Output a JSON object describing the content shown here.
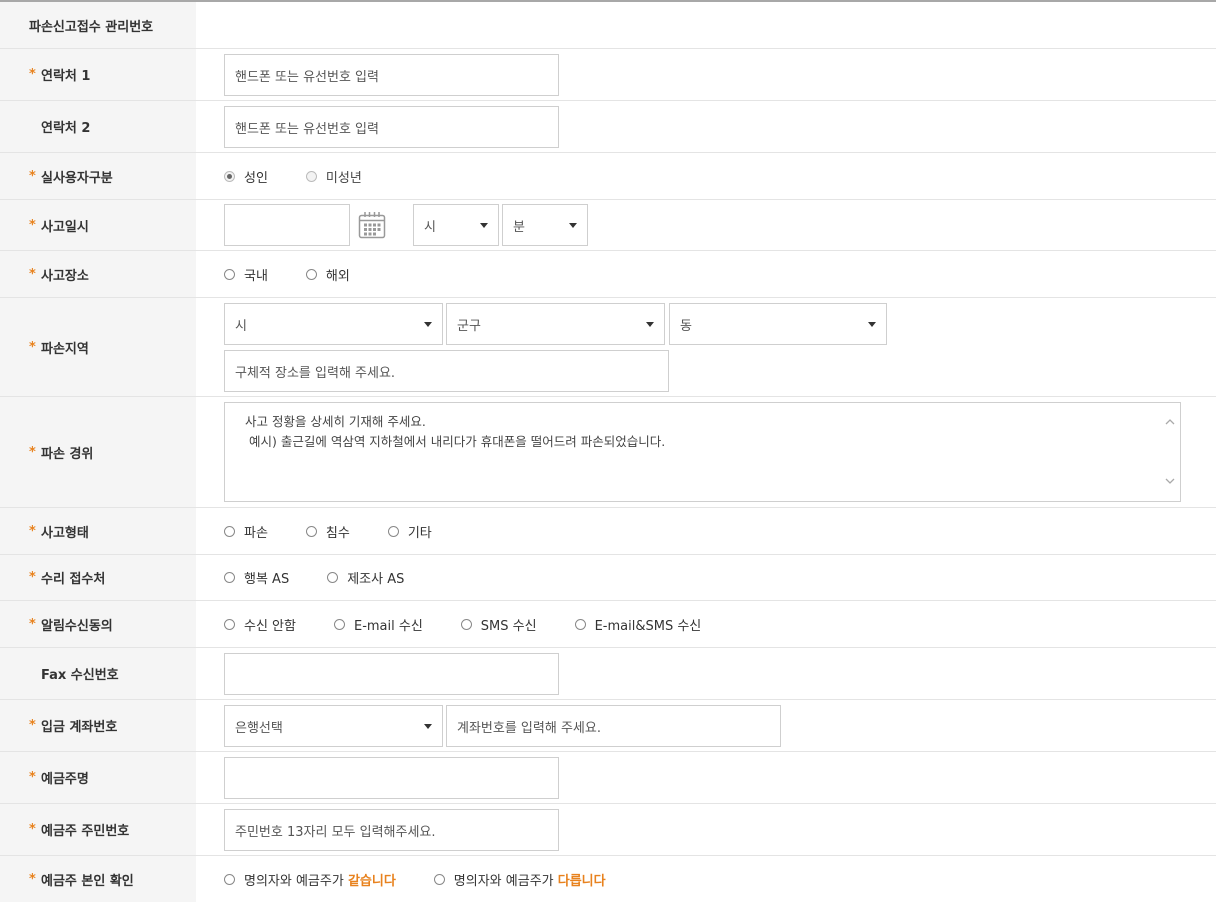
{
  "rows": {
    "mgmt_no": {
      "label": "파손신고접수 관리번호"
    },
    "contact1": {
      "label": "연락처 1",
      "placeholder": "핸드폰 또는 유선번호 입력"
    },
    "contact2": {
      "label": "연락처 2",
      "placeholder": "핸드폰 또는 유선번호 입력"
    },
    "user_type": {
      "label": "실사용자구분",
      "options": [
        "성인",
        "미성년"
      ],
      "selected": "성인"
    },
    "accident_date": {
      "label": "사고일시",
      "hour": "시",
      "minute": "분"
    },
    "accident_place": {
      "label": "사고장소",
      "options": [
        "국내",
        "해외"
      ]
    },
    "damage_area": {
      "label": "파손지역",
      "city": "시",
      "district": "군구",
      "dong": "동",
      "detail_placeholder": "구체적 장소를 입력해 주세요."
    },
    "damage_detail": {
      "label": "파손 경위",
      "line1": "사고 정황을 상세히 기재해 주세요.",
      "line2": "예시) 출근길에 역삼역 지하철에서 내리다가 휴대폰을 떨어드려 파손되었습니다."
    },
    "accident_type": {
      "label": "사고형태",
      "options": [
        "파손",
        "침수",
        "기타"
      ]
    },
    "repair_center": {
      "label": "수리 접수처",
      "options": [
        "행복 AS",
        "제조사 AS"
      ]
    },
    "notice_consent": {
      "label": "알림수신동의",
      "options": [
        "수신 안함",
        "E-mail 수신",
        "SMS 수신",
        "E-mail&SMS 수신"
      ]
    },
    "fax": {
      "label": "Fax 수신번호"
    },
    "bank_account": {
      "label": "입금 계좌번호",
      "bank": "은행선택",
      "account_placeholder": "계좌번호를 입력해 주세요."
    },
    "holder_name": {
      "label": "예금주명"
    },
    "holder_id": {
      "label": "예금주 주민번호",
      "placeholder": "주민번호 13자리 모두 입력해주세요."
    },
    "holder_confirm": {
      "label": "예금주 본인 확인",
      "opt1_prefix": "명의자와 예금주가 ",
      "opt1_hl": "같습니다",
      "opt2_prefix": "명의자와 예금주가 ",
      "opt2_hl": "다릅니다"
    }
  },
  "colors": {
    "required_star": "#e8821e",
    "label_bg": "#f5f5f5",
    "border": "#cfcfcf"
  }
}
